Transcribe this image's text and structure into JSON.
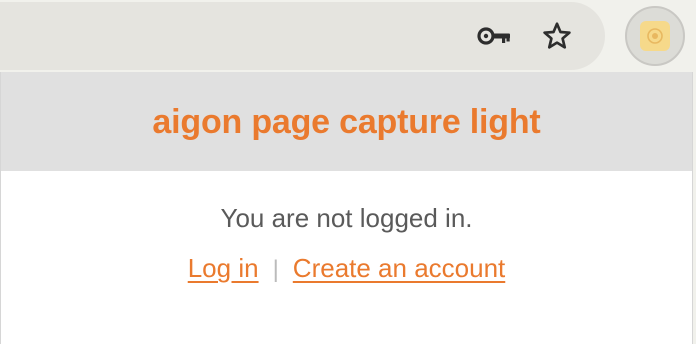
{
  "toolbar": {
    "icons": [
      "key-icon",
      "star-icon"
    ],
    "extension_icon": "aigon-extension-icon"
  },
  "popup": {
    "title": "aigon page capture light",
    "status": "You are not logged in.",
    "login_label": "Log in",
    "separator": "|",
    "create_account_label": "Create an account"
  },
  "colors": {
    "accent": "#ea7a2e",
    "header_bg": "#e0e0e0",
    "status_text": "#5a5a5a",
    "omnibox_bg": "#e5e4df",
    "extension_badge": "#f6d98a"
  }
}
